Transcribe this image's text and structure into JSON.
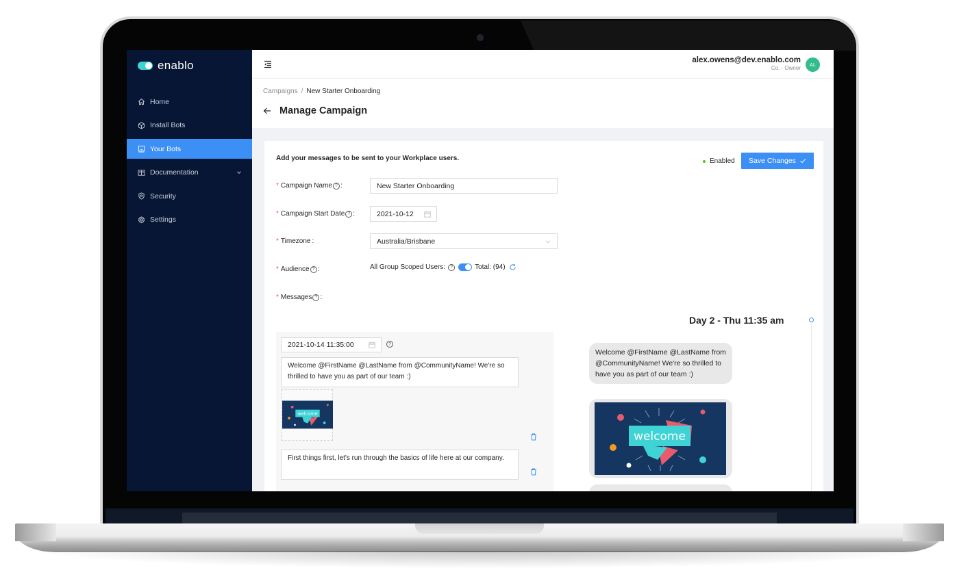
{
  "app": {
    "brand": "enablo"
  },
  "sidebar": {
    "items": [
      {
        "label": "Home",
        "icon": "home-icon",
        "active": false
      },
      {
        "label": "Install Bots",
        "icon": "bot-package-icon",
        "active": false
      },
      {
        "label": "Your Bots",
        "icon": "robot-icon",
        "active": true
      },
      {
        "label": "Documentation",
        "icon": "book-icon",
        "active": false,
        "expandable": true
      },
      {
        "label": "Security",
        "icon": "shield-icon",
        "active": false
      },
      {
        "label": "Settings",
        "icon": "gear-icon",
        "active": false
      }
    ]
  },
  "topbar": {
    "menu_icon": "menu-fold-icon",
    "user_email": "alex.owens@dev.enablo.com",
    "user_role": "Co. · Owner",
    "avatar_initials": "AL",
    "avatar_color": "#33bd8c"
  },
  "breadcrumb": {
    "parent": "Campaigns",
    "separator": "/",
    "current": "New Starter Onboarding"
  },
  "page": {
    "title": "Manage Campaign"
  },
  "form": {
    "description": "Add your messages to be sent to your Workplace users.",
    "status_label": "Enabled",
    "status_color": "#52c41a",
    "save_label": "Save Changes",
    "accent_color": "#3b8ff5",
    "campaign_name_label": "Campaign Name",
    "campaign_name_value": "New Starter Onboarding",
    "start_date_label": "Campaign Start Date",
    "start_date_value": "2021-10-12",
    "timezone_label": "Timezone",
    "timezone_value": "Australia/Brisbane",
    "audience_label": "Audience",
    "audience_text": "All Group Scoped Users:",
    "audience_toggle_on": true,
    "audience_total": "Total: (94)",
    "messages_label": "Messages",
    "required_mark": "*",
    "colon": ":"
  },
  "messages": {
    "datetime_value": "2021-10-14 11:35:00",
    "items": [
      {
        "type": "text",
        "text": "Welcome @FirstName @LastName from @CommunityName! We're so thrilled to have you as part of our team :)"
      },
      {
        "type": "image",
        "alt": "welcome"
      },
      {
        "type": "text",
        "text": "First things first, let's run through the basics of life here at our company."
      }
    ]
  },
  "preview": {
    "day_heading": "Day 2 - Thu 11:35 am",
    "bubble_text": "Welcome @FirstName @LastName from @CommunityName! We're so thrilled to have you as part of our team :)",
    "image_text": "welcome"
  }
}
